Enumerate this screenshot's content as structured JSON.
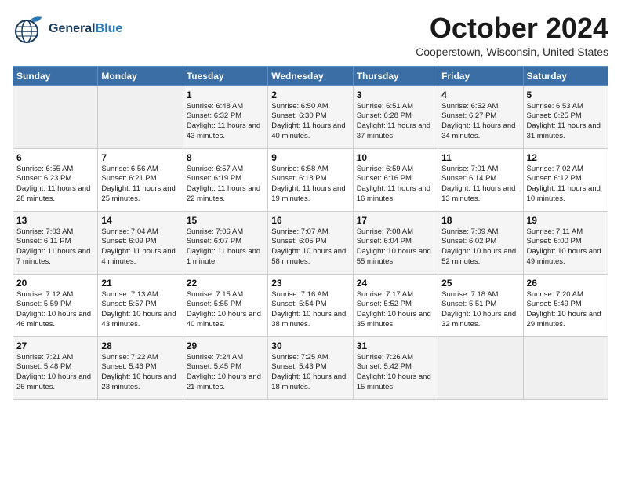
{
  "header": {
    "logo_general": "General",
    "logo_blue": "Blue",
    "month_title": "October 2024",
    "location": "Cooperstown, Wisconsin, United States"
  },
  "weekdays": [
    "Sunday",
    "Monday",
    "Tuesday",
    "Wednesday",
    "Thursday",
    "Friday",
    "Saturday"
  ],
  "weeks": [
    [
      {
        "day": "",
        "sunrise": "",
        "sunset": "",
        "daylight": ""
      },
      {
        "day": "",
        "sunrise": "",
        "sunset": "",
        "daylight": ""
      },
      {
        "day": "1",
        "sunrise": "Sunrise: 6:48 AM",
        "sunset": "Sunset: 6:32 PM",
        "daylight": "Daylight: 11 hours and 43 minutes."
      },
      {
        "day": "2",
        "sunrise": "Sunrise: 6:50 AM",
        "sunset": "Sunset: 6:30 PM",
        "daylight": "Daylight: 11 hours and 40 minutes."
      },
      {
        "day": "3",
        "sunrise": "Sunrise: 6:51 AM",
        "sunset": "Sunset: 6:28 PM",
        "daylight": "Daylight: 11 hours and 37 minutes."
      },
      {
        "day": "4",
        "sunrise": "Sunrise: 6:52 AM",
        "sunset": "Sunset: 6:27 PM",
        "daylight": "Daylight: 11 hours and 34 minutes."
      },
      {
        "day": "5",
        "sunrise": "Sunrise: 6:53 AM",
        "sunset": "Sunset: 6:25 PM",
        "daylight": "Daylight: 11 hours and 31 minutes."
      }
    ],
    [
      {
        "day": "6",
        "sunrise": "Sunrise: 6:55 AM",
        "sunset": "Sunset: 6:23 PM",
        "daylight": "Daylight: 11 hours and 28 minutes."
      },
      {
        "day": "7",
        "sunrise": "Sunrise: 6:56 AM",
        "sunset": "Sunset: 6:21 PM",
        "daylight": "Daylight: 11 hours and 25 minutes."
      },
      {
        "day": "8",
        "sunrise": "Sunrise: 6:57 AM",
        "sunset": "Sunset: 6:19 PM",
        "daylight": "Daylight: 11 hours and 22 minutes."
      },
      {
        "day": "9",
        "sunrise": "Sunrise: 6:58 AM",
        "sunset": "Sunset: 6:18 PM",
        "daylight": "Daylight: 11 hours and 19 minutes."
      },
      {
        "day": "10",
        "sunrise": "Sunrise: 6:59 AM",
        "sunset": "Sunset: 6:16 PM",
        "daylight": "Daylight: 11 hours and 16 minutes."
      },
      {
        "day": "11",
        "sunrise": "Sunrise: 7:01 AM",
        "sunset": "Sunset: 6:14 PM",
        "daylight": "Daylight: 11 hours and 13 minutes."
      },
      {
        "day": "12",
        "sunrise": "Sunrise: 7:02 AM",
        "sunset": "Sunset: 6:12 PM",
        "daylight": "Daylight: 11 hours and 10 minutes."
      }
    ],
    [
      {
        "day": "13",
        "sunrise": "Sunrise: 7:03 AM",
        "sunset": "Sunset: 6:11 PM",
        "daylight": "Daylight: 11 hours and 7 minutes."
      },
      {
        "day": "14",
        "sunrise": "Sunrise: 7:04 AM",
        "sunset": "Sunset: 6:09 PM",
        "daylight": "Daylight: 11 hours and 4 minutes."
      },
      {
        "day": "15",
        "sunrise": "Sunrise: 7:06 AM",
        "sunset": "Sunset: 6:07 PM",
        "daylight": "Daylight: 11 hours and 1 minute."
      },
      {
        "day": "16",
        "sunrise": "Sunrise: 7:07 AM",
        "sunset": "Sunset: 6:05 PM",
        "daylight": "Daylight: 10 hours and 58 minutes."
      },
      {
        "day": "17",
        "sunrise": "Sunrise: 7:08 AM",
        "sunset": "Sunset: 6:04 PM",
        "daylight": "Daylight: 10 hours and 55 minutes."
      },
      {
        "day": "18",
        "sunrise": "Sunrise: 7:09 AM",
        "sunset": "Sunset: 6:02 PM",
        "daylight": "Daylight: 10 hours and 52 minutes."
      },
      {
        "day": "19",
        "sunrise": "Sunrise: 7:11 AM",
        "sunset": "Sunset: 6:00 PM",
        "daylight": "Daylight: 10 hours and 49 minutes."
      }
    ],
    [
      {
        "day": "20",
        "sunrise": "Sunrise: 7:12 AM",
        "sunset": "Sunset: 5:59 PM",
        "daylight": "Daylight: 10 hours and 46 minutes."
      },
      {
        "day": "21",
        "sunrise": "Sunrise: 7:13 AM",
        "sunset": "Sunset: 5:57 PM",
        "daylight": "Daylight: 10 hours and 43 minutes."
      },
      {
        "day": "22",
        "sunrise": "Sunrise: 7:15 AM",
        "sunset": "Sunset: 5:55 PM",
        "daylight": "Daylight: 10 hours and 40 minutes."
      },
      {
        "day": "23",
        "sunrise": "Sunrise: 7:16 AM",
        "sunset": "Sunset: 5:54 PM",
        "daylight": "Daylight: 10 hours and 38 minutes."
      },
      {
        "day": "24",
        "sunrise": "Sunrise: 7:17 AM",
        "sunset": "Sunset: 5:52 PM",
        "daylight": "Daylight: 10 hours and 35 minutes."
      },
      {
        "day": "25",
        "sunrise": "Sunrise: 7:18 AM",
        "sunset": "Sunset: 5:51 PM",
        "daylight": "Daylight: 10 hours and 32 minutes."
      },
      {
        "day": "26",
        "sunrise": "Sunrise: 7:20 AM",
        "sunset": "Sunset: 5:49 PM",
        "daylight": "Daylight: 10 hours and 29 minutes."
      }
    ],
    [
      {
        "day": "27",
        "sunrise": "Sunrise: 7:21 AM",
        "sunset": "Sunset: 5:48 PM",
        "daylight": "Daylight: 10 hours and 26 minutes."
      },
      {
        "day": "28",
        "sunrise": "Sunrise: 7:22 AM",
        "sunset": "Sunset: 5:46 PM",
        "daylight": "Daylight: 10 hours and 23 minutes."
      },
      {
        "day": "29",
        "sunrise": "Sunrise: 7:24 AM",
        "sunset": "Sunset: 5:45 PM",
        "daylight": "Daylight: 10 hours and 21 minutes."
      },
      {
        "day": "30",
        "sunrise": "Sunrise: 7:25 AM",
        "sunset": "Sunset: 5:43 PM",
        "daylight": "Daylight: 10 hours and 18 minutes."
      },
      {
        "day": "31",
        "sunrise": "Sunrise: 7:26 AM",
        "sunset": "Sunset: 5:42 PM",
        "daylight": "Daylight: 10 hours and 15 minutes."
      },
      {
        "day": "",
        "sunrise": "",
        "sunset": "",
        "daylight": ""
      },
      {
        "day": "",
        "sunrise": "",
        "sunset": "",
        "daylight": ""
      }
    ]
  ]
}
